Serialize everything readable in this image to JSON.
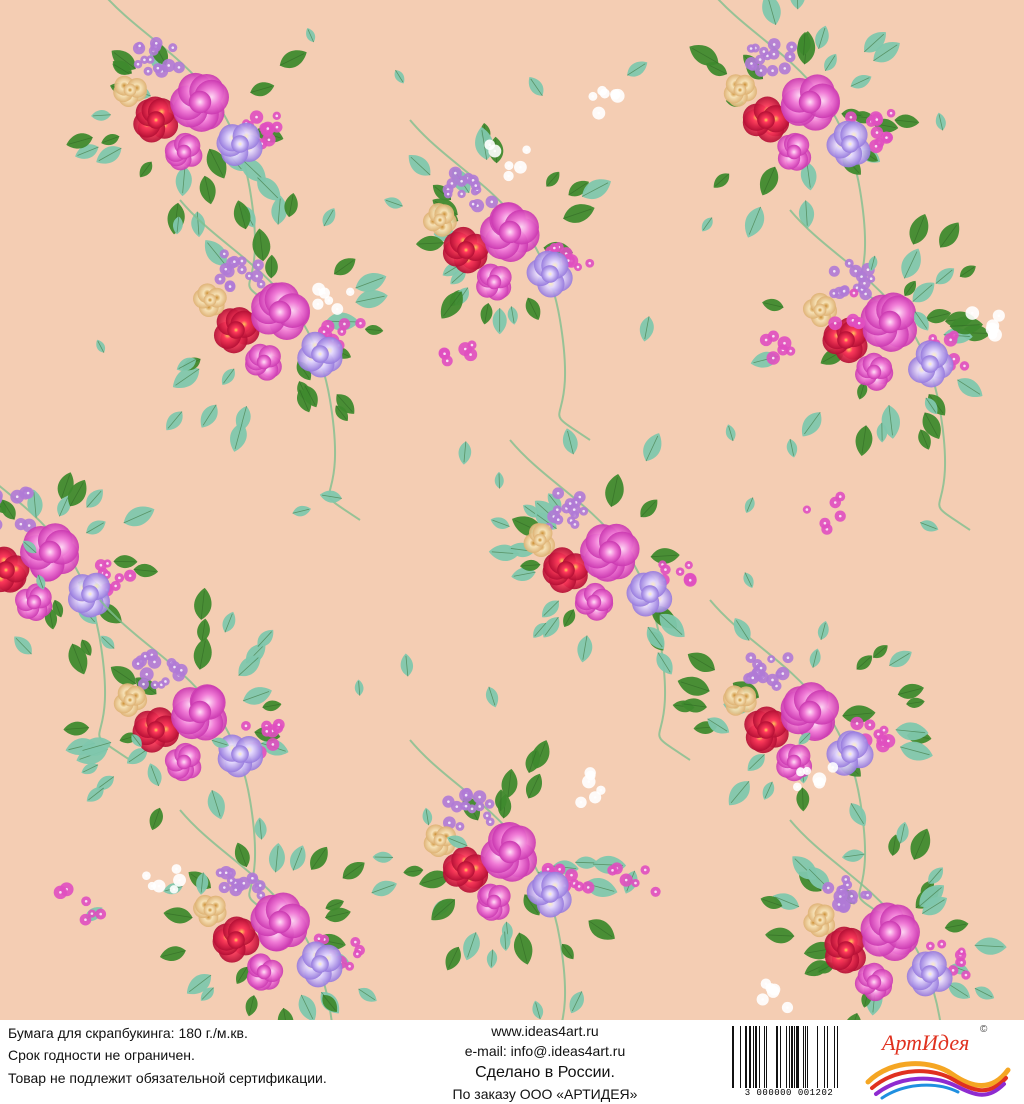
{
  "footer": {
    "left": {
      "line1": "Бумага для скрапбукинга: 180 г./м.кв.",
      "line2": "Срок годности не ограничен.",
      "line3": "Товар не подлежит обязательной сертификации."
    },
    "center": {
      "website": "www.ideas4art.ru",
      "email": "e-mail: info@.ideas4art.ru",
      "made_in": "Сделано в России.",
      "order": "По заказу ООО «АРТИДЕЯ»"
    },
    "barcode_number": "3 000000 001202",
    "logo_text": "АртИдея",
    "logo_mark": "©"
  },
  "colors": {
    "background": "#f4cdb3",
    "leaf_dark": "#3f8a2e",
    "leaf_teal": "#7fc7ad",
    "rose_pink": "#ee62c8",
    "red": "#d8163c",
    "violet": "#a58be6",
    "lilac": "#b07ad6",
    "logo_red": "#e0311f"
  },
  "icons": [
    "floral-pattern",
    "barcode-icon",
    "artideya-logo-icon"
  ]
}
